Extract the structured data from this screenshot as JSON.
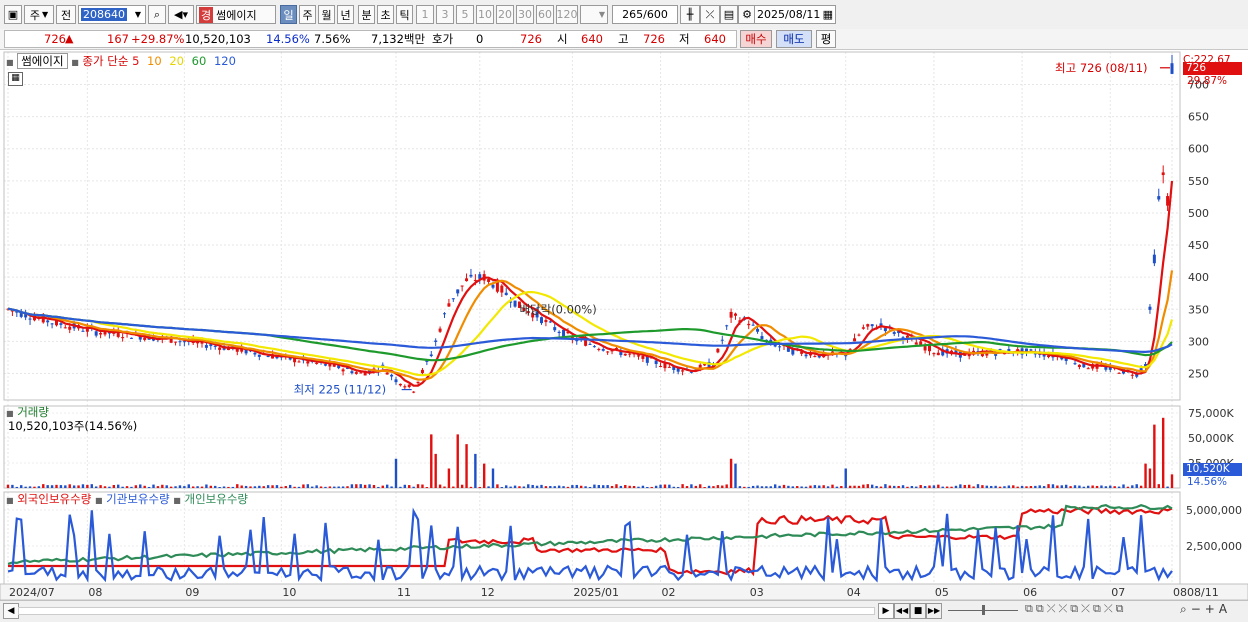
{
  "toolbar": {
    "period_type": "주",
    "prev_label": "전",
    "stock_code": "208640",
    "stock_badge": "경",
    "stock_name": "썸에이지",
    "tabs": [
      "일",
      "주",
      "월",
      "년",
      "분",
      "초",
      "틱"
    ],
    "active_tab": "일",
    "intervals": [
      "1",
      "3",
      "5",
      "10",
      "20",
      "30",
      "60",
      "120"
    ],
    "count": "265",
    "count_max": "/600",
    "date": "2025/08/11"
  },
  "quote": {
    "price": "726",
    "change": "167",
    "change_pct": "+29.87%",
    "volume": "10,520,103",
    "vol_pct": "14.56%",
    "turnover_pct": "7.56%",
    "amount": "7,132백만",
    "hoga_label": "호가",
    "hoga_value": "0",
    "hoga_price": "726",
    "open_label": "시",
    "open_value": "640",
    "high_label": "고",
    "high_value": "726",
    "low_label": "저",
    "low_value": "640",
    "buy_label": "매수",
    "sell_label": "매도",
    "flat_label": "평"
  },
  "price_panel": {
    "name_tag": "썸에이지",
    "ma_label": "종가 단순",
    "ma_periods": [
      "5",
      "10",
      "20",
      "60",
      "120"
    ],
    "ma_colors": [
      "#e01010",
      "#f08c00",
      "#f2e800",
      "#1e9a2c",
      "#2a5ad8"
    ],
    "high_annot": "최고 726 (08/11)",
    "low_annot": "최저 225 (11/12)",
    "ex_div": "배당락(0.00%)",
    "price_badge": "726",
    "pct_badge": "29.87%",
    "top_label": "C:222.67"
  },
  "volume_panel": {
    "title": "거래량",
    "summary": "10,520,103주(14.56%)",
    "badge": "10,520K",
    "badge_pct": "14.56%"
  },
  "holdings_panel": {
    "labels": [
      "외국인보유수량",
      "기관보유수량",
      "개인보유수량"
    ],
    "colors": [
      "#e01010",
      "#2a5ad8",
      "#2e8b57"
    ]
  },
  "chart_data": {
    "type": "candlestick",
    "x_ticks": [
      "2024/07",
      "08",
      "09",
      "10",
      "11",
      "12",
      "2025/01",
      "02",
      "03",
      "04",
      "05",
      "06",
      "07",
      "08",
      "08/11"
    ],
    "price_y_ticks": [
      250,
      300,
      350,
      400,
      450,
      500,
      550,
      600,
      650,
      700
    ],
    "volume_y_ticks": [
      "75,000K",
      "50,000K",
      "25,000K"
    ],
    "holdings_y_ticks": [
      "5,000,000",
      "2,500,000"
    ],
    "last_close": 726,
    "high": 726,
    "high_date": "08/11",
    "low": 225,
    "low_date": "11/12"
  }
}
